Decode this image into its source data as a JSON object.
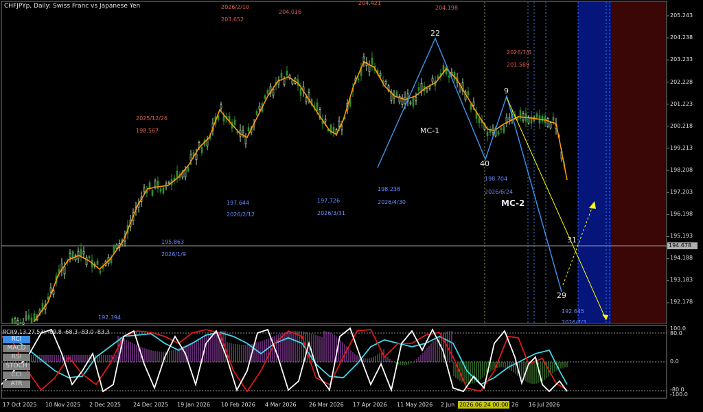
{
  "title": "CHFJPYp, Daily:  Swiss Franc vs Japanese Yen",
  "price_axis": [
    "205.243",
    "204.238",
    "203.233",
    "202.228",
    "201.223",
    "200.218",
    "199.213",
    "198.208",
    "197.203",
    "196.198",
    "195.193",
    "194.188",
    "193.183",
    "192.178"
  ],
  "current_price": "194.678",
  "time_axis": [
    "17 Oct 2025",
    "10 Nov 2025",
    "2 Dec 2025",
    "24 Dec 2025",
    "19 Jan 2026",
    "10 Feb 2026",
    "4 Mar 2026",
    "26 Mar 2026",
    "17 Apr 2026",
    "11 May 2026",
    "2 Jun",
    "26",
    "16 Jul 2026"
  ],
  "time_cursor": "2026.06.24 00:00",
  "annotations": {
    "a1_price": "192.394",
    "a2_price": "195.863",
    "a2_date": "2026/1/9",
    "a3_date": "2025/12/26",
    "a3_price": "198.567",
    "a4_price": "197.644",
    "a4_date": "2026/2/12",
    "a5_date": "2026/2/10",
    "a5_price": "203.652",
    "a6_price": "204.016",
    "a7_price": "204.421",
    "a8_price": "197.726",
    "a8_date": "2026/3/31",
    "a9_price": "198.238",
    "a9_date": "2026/4/30",
    "a10_price": "204.198",
    "a11_price": "198.704",
    "a11_date": "2026/6/24",
    "a12_date": "2026/7/6",
    "a12_price": "201.589",
    "a13_price": "192.645",
    "a13_date": "2026/7/3"
  },
  "waves": {
    "w22": "22",
    "w40": "40",
    "w9": "9",
    "w29": "29",
    "w31": "31"
  },
  "labels": {
    "mc1": "MC-1",
    "mc2": "MC-2"
  },
  "indicator": {
    "header": "RCI(9,13,27,53) -69.8 -68.3 -83.0 -83.3",
    "buttons": [
      "RCI",
      "MACD",
      "RSI",
      "STOCH",
      "CCI",
      "ATR"
    ],
    "active": "RCI",
    "levels": [
      "100.0",
      "80.0",
      "0.0",
      "-80.0",
      "-100.0"
    ]
  },
  "colors": {
    "bull": "#b8e0b0",
    "bear": "#2f8f2f",
    "ma": "#ff9900",
    "wave": "#3a8ee6",
    "zone_blue": "#05157a",
    "zone_red": "#3a0606"
  }
}
